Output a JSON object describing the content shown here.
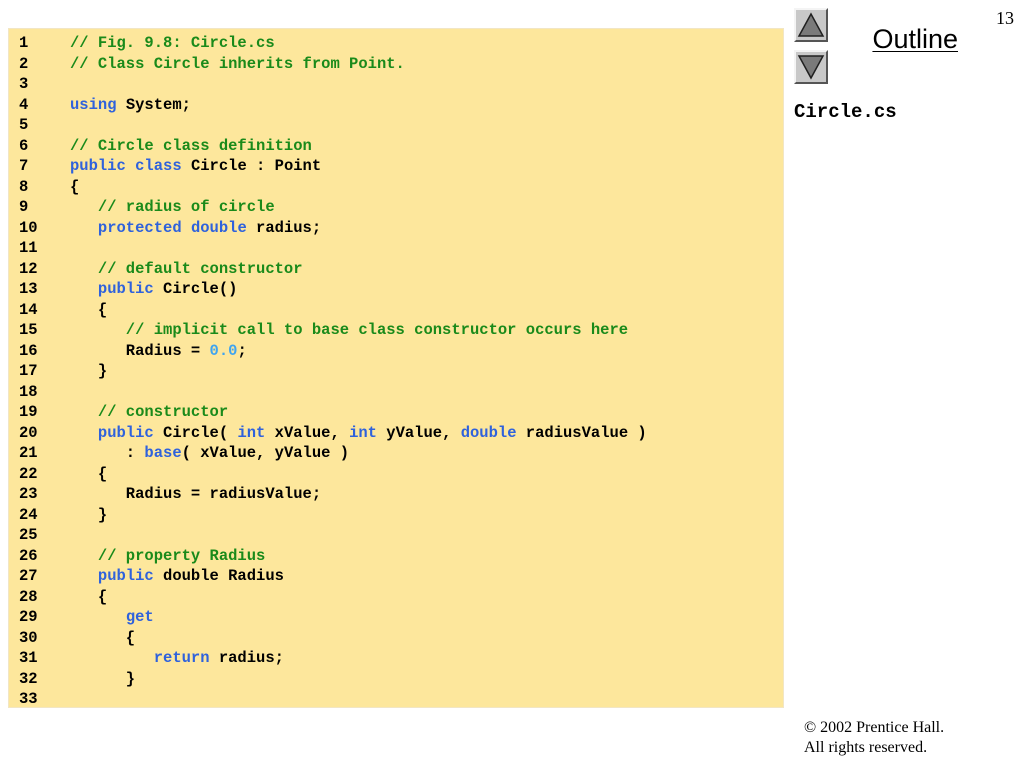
{
  "slide": {
    "page_number": "13",
    "outline_label": "Outline",
    "file_name": "Circle.cs",
    "copyright_line1": "© 2002 Prentice Hall.",
    "copyright_line2": "All rights reserved.",
    "nav_up_icon": "up-triangle-icon",
    "nav_down_icon": "down-triangle-icon"
  },
  "colors": {
    "panel_background": "#fde79c",
    "comment": "#1a8a1a",
    "keyword": "#2f62dc",
    "number_literal": "#3ea4f0",
    "plain": "#000000"
  },
  "code_lines": [
    {
      "no": "1",
      "tokens": [
        {
          "t": "// Fig. 9.8: Circle.cs",
          "k": "comment"
        }
      ]
    },
    {
      "no": "2",
      "tokens": [
        {
          "t": "// Class Circle inherits from Point.",
          "k": "comment"
        }
      ]
    },
    {
      "no": "3",
      "tokens": []
    },
    {
      "no": "4",
      "tokens": [
        {
          "t": "using",
          "k": "keyword"
        },
        {
          "t": " System;",
          "k": "plain"
        }
      ]
    },
    {
      "no": "5",
      "tokens": []
    },
    {
      "no": "6",
      "tokens": [
        {
          "t": "// Circle class definition",
          "k": "comment"
        }
      ]
    },
    {
      "no": "7",
      "tokens": [
        {
          "t": "public",
          "k": "keyword"
        },
        {
          "t": " ",
          "k": "plain"
        },
        {
          "t": "class",
          "k": "keyword"
        },
        {
          "t": " Circle : Point",
          "k": "plain"
        }
      ]
    },
    {
      "no": "8",
      "tokens": [
        {
          "t": "{",
          "k": "plain"
        }
      ]
    },
    {
      "no": "9",
      "tokens": [
        {
          "t": "   // radius of circle",
          "k": "comment"
        }
      ]
    },
    {
      "no": "10",
      "tokens": [
        {
          "t": "   ",
          "k": "plain"
        },
        {
          "t": "protected",
          "k": "keyword"
        },
        {
          "t": " ",
          "k": "plain"
        },
        {
          "t": "double",
          "k": "keyword"
        },
        {
          "t": " radius;",
          "k": "plain"
        }
      ]
    },
    {
      "no": "11",
      "tokens": []
    },
    {
      "no": "12",
      "tokens": [
        {
          "t": "   // default constructor",
          "k": "comment"
        }
      ]
    },
    {
      "no": "13",
      "tokens": [
        {
          "t": "   ",
          "k": "plain"
        },
        {
          "t": "public",
          "k": "keyword"
        },
        {
          "t": " Circle()",
          "k": "plain"
        }
      ]
    },
    {
      "no": "14",
      "tokens": [
        {
          "t": "   {",
          "k": "plain"
        }
      ]
    },
    {
      "no": "15",
      "tokens": [
        {
          "t": "      // implicit call to base class constructor occurs here",
          "k": "comment"
        }
      ]
    },
    {
      "no": "16",
      "tokens": [
        {
          "t": "      Radius = ",
          "k": "plain"
        },
        {
          "t": "0.0",
          "k": "number"
        },
        {
          "t": ";",
          "k": "plain"
        }
      ]
    },
    {
      "no": "17",
      "tokens": [
        {
          "t": "   }",
          "k": "plain"
        }
      ]
    },
    {
      "no": "18",
      "tokens": []
    },
    {
      "no": "19",
      "tokens": [
        {
          "t": "   // constructor",
          "k": "comment"
        }
      ]
    },
    {
      "no": "20",
      "tokens": [
        {
          "t": "   ",
          "k": "plain"
        },
        {
          "t": "public",
          "k": "keyword"
        },
        {
          "t": " Circle( ",
          "k": "plain"
        },
        {
          "t": "int",
          "k": "keyword"
        },
        {
          "t": " xValue, ",
          "k": "plain"
        },
        {
          "t": "int",
          "k": "keyword"
        },
        {
          "t": " yValue, ",
          "k": "plain"
        },
        {
          "t": "double",
          "k": "keyword"
        },
        {
          "t": " radiusValue )",
          "k": "plain"
        }
      ]
    },
    {
      "no": "21",
      "tokens": [
        {
          "t": "      : ",
          "k": "plain"
        },
        {
          "t": "base",
          "k": "keyword"
        },
        {
          "t": "( xValue, yValue )",
          "k": "plain"
        }
      ]
    },
    {
      "no": "22",
      "tokens": [
        {
          "t": "   {",
          "k": "plain"
        }
      ]
    },
    {
      "no": "23",
      "tokens": [
        {
          "t": "      Radius = radiusValue;",
          "k": "plain"
        }
      ]
    },
    {
      "no": "24",
      "tokens": [
        {
          "t": "   }",
          "k": "plain"
        }
      ]
    },
    {
      "no": "25",
      "tokens": []
    },
    {
      "no": "26",
      "tokens": [
        {
          "t": "   // property Radius",
          "k": "comment"
        }
      ]
    },
    {
      "no": "27",
      "tokens": [
        {
          "t": "   ",
          "k": "plain"
        },
        {
          "t": "public",
          "k": "keyword"
        },
        {
          "t": " double Radius",
          "k": "plain"
        }
      ]
    },
    {
      "no": "28",
      "tokens": [
        {
          "t": "   {",
          "k": "plain"
        }
      ]
    },
    {
      "no": "29",
      "tokens": [
        {
          "t": "      ",
          "k": "plain"
        },
        {
          "t": "get",
          "k": "keyword"
        }
      ]
    },
    {
      "no": "30",
      "tokens": [
        {
          "t": "      {",
          "k": "plain"
        }
      ]
    },
    {
      "no": "31",
      "tokens": [
        {
          "t": "         ",
          "k": "plain"
        },
        {
          "t": "return",
          "k": "keyword"
        },
        {
          "t": " radius;",
          "k": "plain"
        }
      ]
    },
    {
      "no": "32",
      "tokens": [
        {
          "t": "      }",
          "k": "plain"
        }
      ]
    },
    {
      "no": "33",
      "tokens": []
    }
  ]
}
